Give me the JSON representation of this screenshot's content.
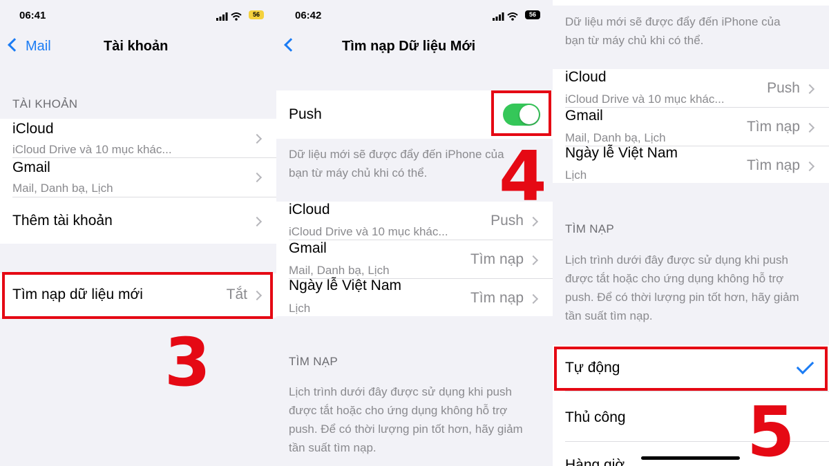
{
  "panel1": {
    "time": "06:41",
    "battery": "56",
    "back_label": "Mail",
    "title": "Tài khoản",
    "section_header": "TÀI KHOẢN",
    "accounts": [
      {
        "name": "iCloud",
        "detail": "iCloud Drive và 10 mục khác..."
      },
      {
        "name": "Gmail",
        "detail": "Mail, Danh bạ, Lịch"
      }
    ],
    "add_account": "Thêm tài khoản",
    "fetch_row": {
      "label": "Tìm nạp dữ liệu mới",
      "value": "Tắt"
    },
    "step_number": "3"
  },
  "panel2": {
    "time": "06:42",
    "battery": "56",
    "title": "Tìm nạp Dữ liệu Mới",
    "push_label": "Push",
    "push_on": true,
    "push_footer": "Dữ liệu mới sẽ được đẩy đến iPhone của bạn từ máy chủ khi có thể.",
    "accounts": [
      {
        "name": "iCloud",
        "detail": "iCloud Drive và 10 mục khác...",
        "value": "Push"
      },
      {
        "name": "Gmail",
        "detail": "Mail, Danh bạ, Lịch",
        "value": "Tìm nạp"
      },
      {
        "name": "Ngày lễ Việt Nam",
        "detail": "Lịch",
        "value": "Tìm nạp"
      }
    ],
    "fetch_header": "TÌM NẠP",
    "fetch_footer": "Lịch trình dưới đây được sử dụng khi push được tắt hoặc cho ứng dụng không hỗ trợ push. Để có thời lượng pin tốt hơn, hãy giảm tần suất tìm nạp.",
    "step_number": "4"
  },
  "panel3": {
    "push_footer": "Dữ liệu mới sẽ được đẩy đến iPhone của bạn từ máy chủ khi có thể.",
    "accounts": [
      {
        "name": "iCloud",
        "detail": "iCloud Drive và 10 mục khác...",
        "value": "Push"
      },
      {
        "name": "Gmail",
        "detail": "Mail, Danh bạ, Lịch",
        "value": "Tìm nạp"
      },
      {
        "name": "Ngày lễ Việt Nam",
        "detail": "Lịch",
        "value": "Tìm nạp"
      }
    ],
    "fetch_header": "TÌM NẠP",
    "fetch_footer": "Lịch trình dưới đây được sử dụng khi push được tắt hoặc cho ứng dụng không hỗ trợ push. Để có thời lượng pin tốt hơn, hãy giảm tần suất tìm nạp.",
    "options": [
      "Tự động",
      "Thủ công",
      "Hàng giờ"
    ],
    "selected_option": "Tự động",
    "step_number": "5"
  },
  "colors": {
    "accent": "#1b7cf4",
    "highlight": "#e50914",
    "toggle_on": "#35c759"
  }
}
